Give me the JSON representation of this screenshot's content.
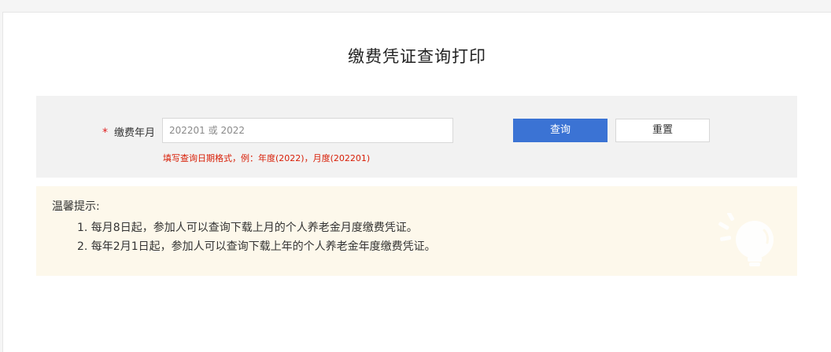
{
  "page": {
    "title": "缴费凭证查询打印"
  },
  "form": {
    "required_mark": "*",
    "label": "缴费年月",
    "input_value": "",
    "input_placeholder": "202201 或 2022",
    "hint": "填写查询日期格式，例：年度(2022)，月度(202201)"
  },
  "buttons": {
    "query": "查询",
    "reset": "重置"
  },
  "tips": {
    "title": "温馨提示:",
    "items": [
      "1. 每月8日起，参加人可以查询下载上月的个人养老金月度缴费凭证。",
      "2. 每年2月1日起，参加人可以查询下载上年的个人养老金年度缴费凭证。"
    ]
  },
  "icons": {
    "tips_decoration": "lightbulb-icon"
  },
  "colors": {
    "primary": "#3b73d4",
    "hint_red": "#d81e06",
    "tips_bg": "#fdf8eb",
    "panel_bg": "#f2f2f2"
  }
}
